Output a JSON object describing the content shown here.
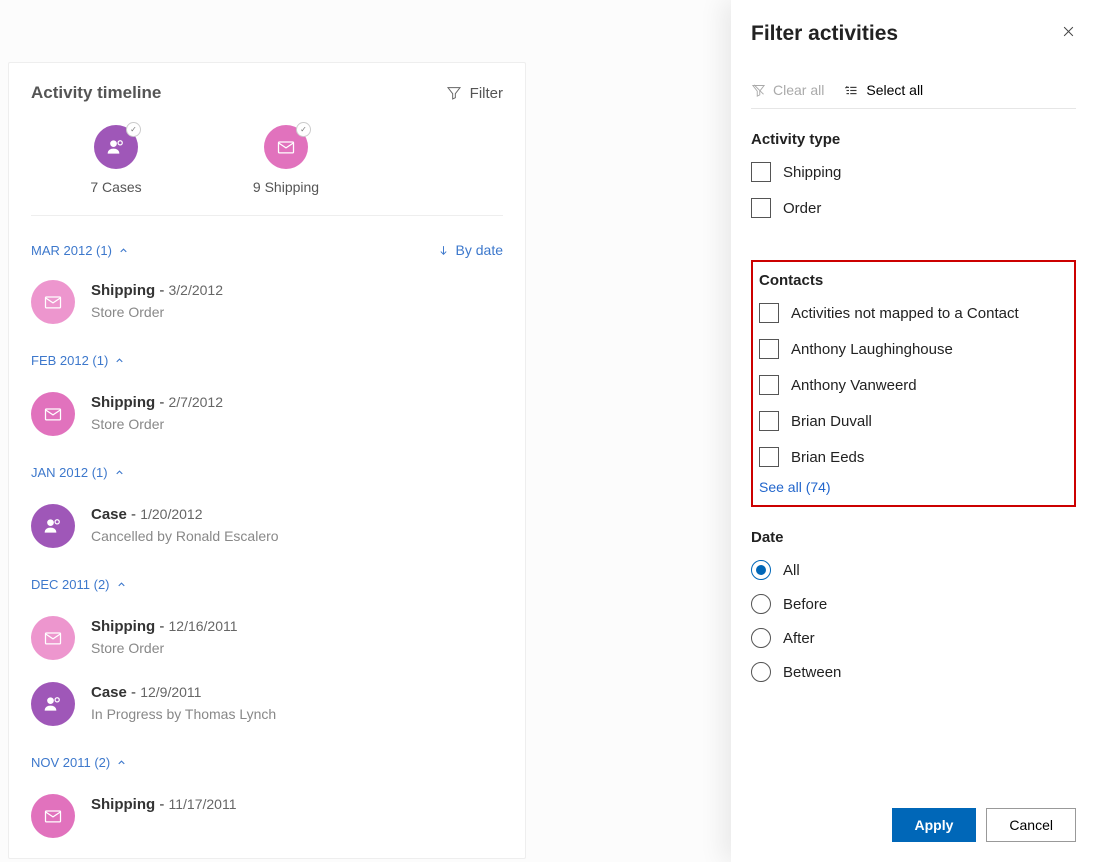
{
  "main": {
    "title": "Activity timeline",
    "filter_label": "Filter",
    "summary": {
      "cases": {
        "count": "7 Cases"
      },
      "shipping": {
        "count": "9 Shipping"
      }
    },
    "sort_label": "By date",
    "groups": [
      {
        "header": "MAR 2012 (1)",
        "items": [
          {
            "type": "ship",
            "title": "Shipping",
            "date": "3/2/2012",
            "subtitle": "Store Order",
            "light": true
          }
        ]
      },
      {
        "header": "FEB 2012 (1)",
        "items": [
          {
            "type": "ship",
            "title": "Shipping",
            "date": "2/7/2012",
            "subtitle": "Store Order",
            "light": false
          }
        ]
      },
      {
        "header": "JAN 2012 (1)",
        "items": [
          {
            "type": "case",
            "title": "Case",
            "date": "1/20/2012",
            "subtitle": "Cancelled by Ronald Escalero"
          }
        ]
      },
      {
        "header": "DEC 2011 (2)",
        "items": [
          {
            "type": "ship",
            "title": "Shipping",
            "date": "12/16/2011",
            "subtitle": "Store Order",
            "light": true
          },
          {
            "type": "case",
            "title": "Case",
            "date": "12/9/2011",
            "subtitle": "In Progress by Thomas Lynch"
          }
        ]
      },
      {
        "header": "NOV 2011 (2)",
        "items": [
          {
            "type": "ship",
            "title": "Shipping",
            "date": "11/17/2011",
            "subtitle": "",
            "light": false
          }
        ]
      }
    ]
  },
  "panel": {
    "title": "Filter activities",
    "clear_all": "Clear all",
    "select_all": "Select all",
    "activity_type": {
      "title": "Activity type",
      "options": [
        "Shipping",
        "Order"
      ]
    },
    "contacts": {
      "title": "Contacts",
      "options": [
        "Activities not mapped to a Contact",
        "Anthony Laughinghouse",
        "Anthony Vanweerd",
        "Brian Duvall",
        "Brian Eeds"
      ],
      "see_all": "See all (74)"
    },
    "date": {
      "title": "Date",
      "options": [
        "All",
        "Before",
        "After",
        "Between"
      ],
      "selected": "All"
    },
    "apply": "Apply",
    "cancel": "Cancel"
  }
}
